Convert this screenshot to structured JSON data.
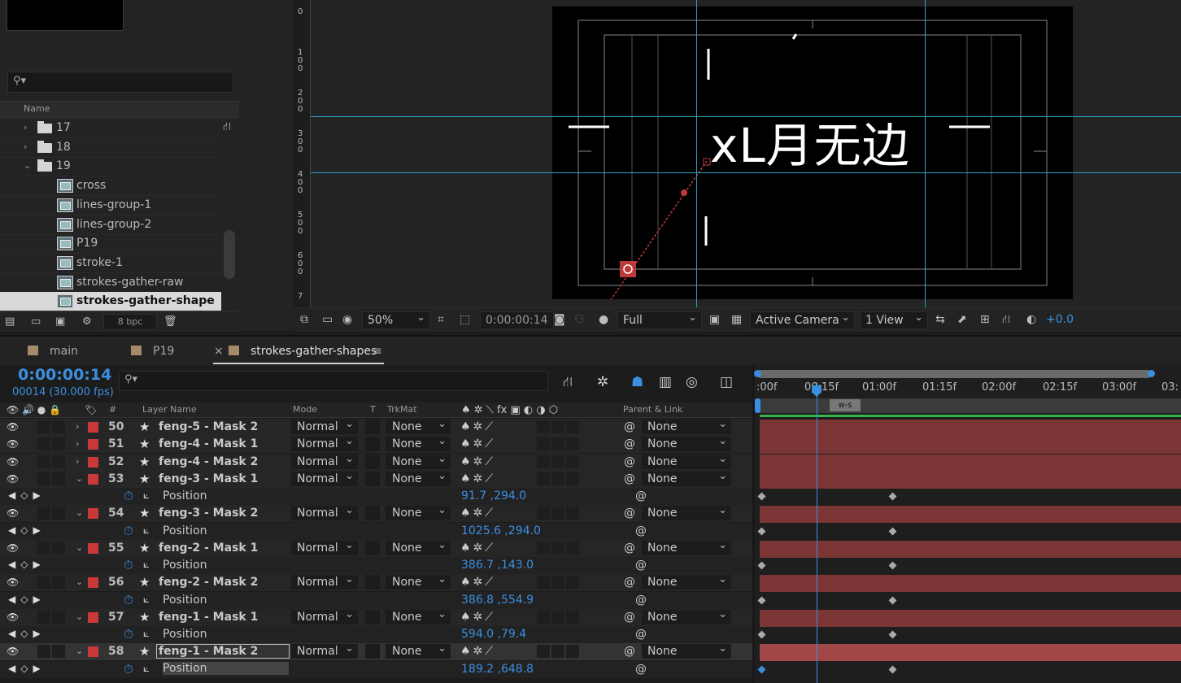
{
  "project": {
    "column_name": "Name",
    "items": [
      {
        "type": "folder",
        "label": "17",
        "expanded": false
      },
      {
        "type": "folder",
        "label": "18",
        "expanded": false
      },
      {
        "type": "folder",
        "label": "19",
        "expanded": true
      },
      {
        "type": "comp",
        "label": "cross"
      },
      {
        "type": "comp",
        "label": "lines-group-1"
      },
      {
        "type": "comp",
        "label": "lines-group-2"
      },
      {
        "type": "comp",
        "label": "P19"
      },
      {
        "type": "comp",
        "label": "stroke-1"
      },
      {
        "type": "comp",
        "label": "strokes-gather-raw"
      },
      {
        "type": "comp",
        "label": "strokes-gather-shape",
        "selected": true
      }
    ],
    "bpc": "8 bpc"
  },
  "viewer": {
    "comp_text": "xL月无边",
    "ruler_labels": [
      "0",
      "100",
      "200",
      "300",
      "400",
      "500",
      "600",
      "7"
    ],
    "zoom": "50%",
    "timecode": "0:00:00:14",
    "resolution": "Full",
    "camera": "Active Camera",
    "views": "1 View",
    "exposure": "+0.0"
  },
  "timeline": {
    "tabs": [
      {
        "label": "main",
        "active": false
      },
      {
        "label": "P19",
        "active": false
      },
      {
        "label": "strokes-gather-shapes",
        "active": true
      }
    ],
    "current_time": "0:00:00:14",
    "frame_info": "00014 (30.000 fps)",
    "headers": {
      "layer_name": "Layer Name",
      "mode": "Mode",
      "t": "T",
      "trkmat": "TrkMat",
      "parent": "Parent & Link"
    },
    "ruler_ticks": [
      ":00f",
      "00:15f",
      "01:00f",
      "01:15f",
      "02:00f",
      "02:15f",
      "03:00f",
      "03:"
    ],
    "work_marker": "w-s",
    "layers": [
      {
        "num": "50",
        "name": "feng-5 - Mask 2",
        "mode": "Normal",
        "trkmat": "None",
        "parent": "None",
        "expanded": false
      },
      {
        "num": "51",
        "name": "feng-4 - Mask 1",
        "mode": "Normal",
        "trkmat": "None",
        "parent": "None",
        "expanded": false
      },
      {
        "num": "52",
        "name": "feng-4 - Mask 2",
        "mode": "Normal",
        "trkmat": "None",
        "parent": "None",
        "expanded": false
      },
      {
        "num": "53",
        "name": "feng-3 - Mask 1",
        "mode": "Normal",
        "trkmat": "None",
        "parent": "None",
        "expanded": true,
        "property": "Position",
        "value": "91.7 ,294.0"
      },
      {
        "num": "54",
        "name": "feng-3 - Mask 2",
        "mode": "Normal",
        "trkmat": "None",
        "parent": "None",
        "expanded": true,
        "property": "Position",
        "value": "1025.6 ,294.0"
      },
      {
        "num": "55",
        "name": "feng-2 - Mask 1",
        "mode": "Normal",
        "trkmat": "None",
        "parent": "None",
        "expanded": true,
        "property": "Position",
        "value": "386.7 ,143.0"
      },
      {
        "num": "56",
        "name": "feng-2 - Mask 2",
        "mode": "Normal",
        "trkmat": "None",
        "parent": "None",
        "expanded": true,
        "property": "Position",
        "value": "386.8 ,554.9"
      },
      {
        "num": "57",
        "name": "feng-1 - Mask 1",
        "mode": "Normal",
        "trkmat": "None",
        "parent": "None",
        "expanded": true,
        "property": "Position",
        "value": "594.0 ,79.4"
      },
      {
        "num": "58",
        "name": "feng-1 - Mask 2",
        "mode": "Normal",
        "trkmat": "None",
        "parent": "None",
        "expanded": true,
        "selected": true,
        "property": "Position",
        "value": "189.2 ,648.8"
      }
    ]
  },
  "colors": {
    "accent": "#3b8fe0",
    "label_red": "#c9393a",
    "bar_red": "#7c3535",
    "guide": "#2ba3c7",
    "work_green": "#36b64a"
  }
}
